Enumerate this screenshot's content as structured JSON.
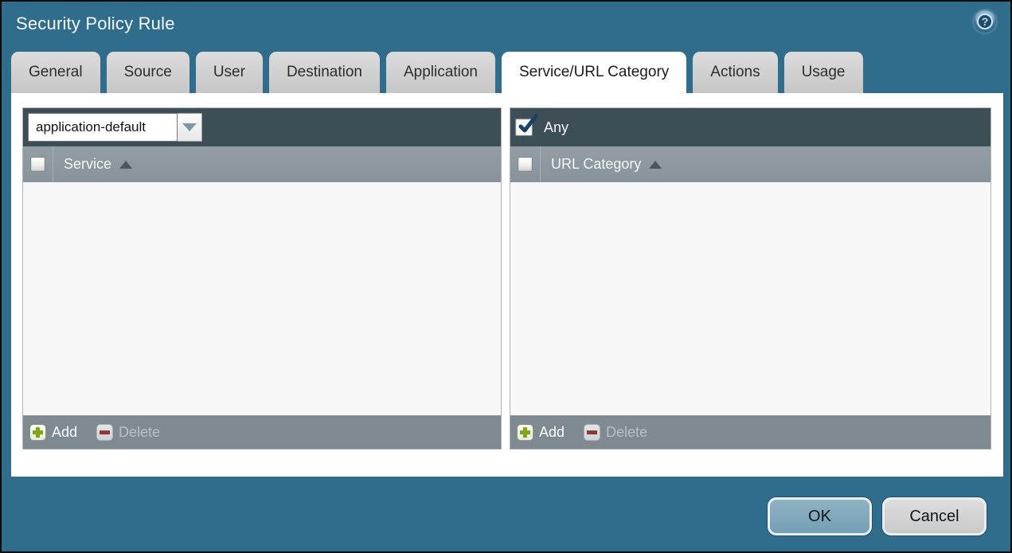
{
  "window": {
    "title": "Security Policy Rule",
    "help_icon": "?"
  },
  "tabs": [
    {
      "label": "General",
      "active": false
    },
    {
      "label": "Source",
      "active": false
    },
    {
      "label": "User",
      "active": false
    },
    {
      "label": "Destination",
      "active": false
    },
    {
      "label": "Application",
      "active": false
    },
    {
      "label": "Service/URL Category",
      "active": true
    },
    {
      "label": "Actions",
      "active": false
    },
    {
      "label": "Usage",
      "active": false
    }
  ],
  "service_panel": {
    "dropdown": {
      "value": "application-default"
    },
    "select_all_checked": false,
    "column_header": "Service",
    "sort": "ascending",
    "rows": [],
    "footer": {
      "add_label": "Add",
      "delete_label": "Delete",
      "delete_enabled": false
    }
  },
  "url_category_panel": {
    "any_label": "Any",
    "any_checked": true,
    "select_all_checked": false,
    "column_header": "URL Category",
    "sort": "ascending",
    "rows": [],
    "footer": {
      "add_label": "Add",
      "delete_label": "Delete",
      "delete_enabled": false
    }
  },
  "dialog_buttons": {
    "ok_label": "OK",
    "cancel_label": "Cancel"
  },
  "colors": {
    "dialog_background": "#306C8B",
    "panel_header_dark": "#3E4E57",
    "column_header_gray": "#8C979D",
    "panel_footer_gray": "#7E8A90",
    "active_tab": "#FFFFFF",
    "inactive_tab": "#C9C9C9",
    "ok_button": "#7BA4B8",
    "cancel_button": "#D2D2D2",
    "add_icon_green": "#7FA51A",
    "delete_icon_red": "#8C3B33",
    "check_navy": "#1C4166"
  }
}
